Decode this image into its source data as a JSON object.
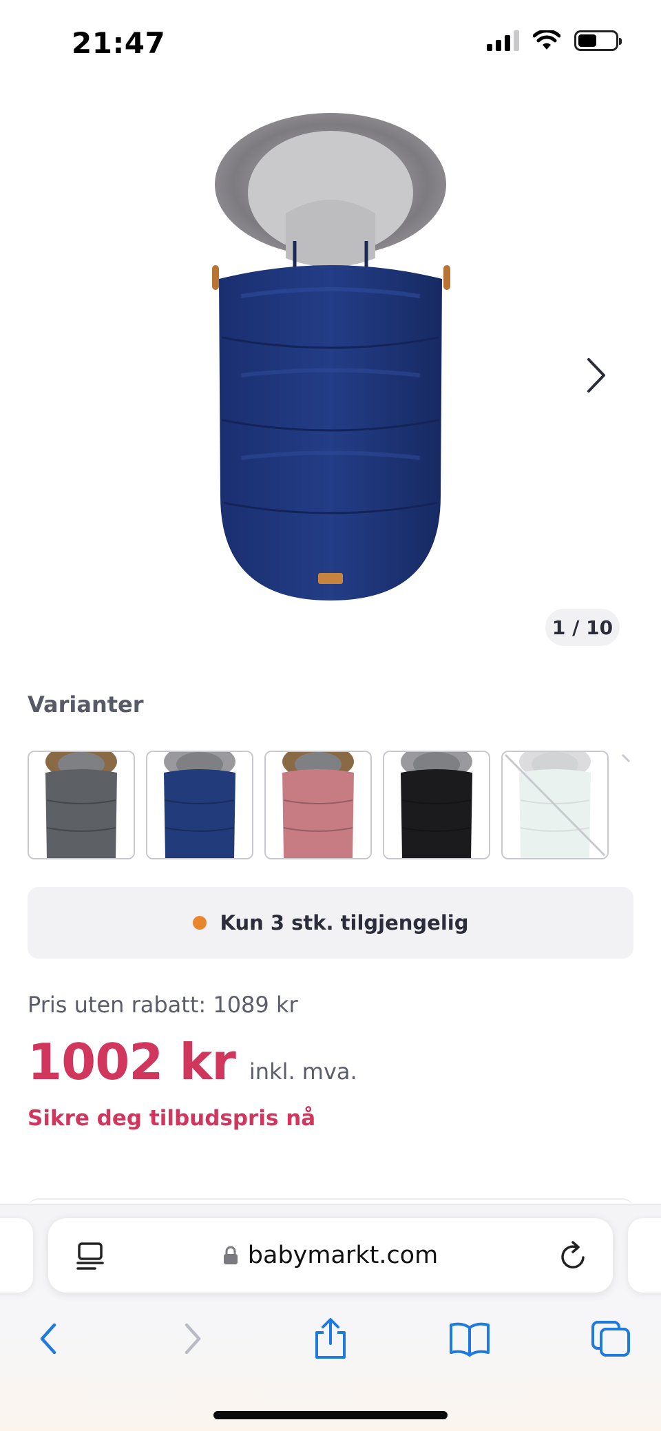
{
  "status_bar": {
    "time": "21:47",
    "icons": [
      "cellular-signal-icon",
      "wifi-icon",
      "battery-icon"
    ]
  },
  "gallery": {
    "counter": "1 / 10",
    "next_icon": "chevron-right-icon"
  },
  "variants": {
    "heading": "Varianter",
    "items": [
      {
        "color": "#5d6064",
        "sold_out": false
      },
      {
        "color": "#223b7a",
        "sold_out": false
      },
      {
        "color": "#c77c84",
        "sold_out": false
      },
      {
        "color": "#1b1b1d",
        "sold_out": false
      },
      {
        "color": "#bfd9d0",
        "sold_out": true
      }
    ]
  },
  "availability": {
    "text": "Kun 3 stk. tilgjengelig",
    "dot_color": "#e8862e"
  },
  "price": {
    "original": "Pris uten rabatt: 1089 kr",
    "current": "1002 kr",
    "vat_note": "inkl. mva.",
    "offer": "Sikre deg tilbudspris nå",
    "accent_color": "#d1365d"
  },
  "browser": {
    "url": "babymarkt.com",
    "toolbar_icons": [
      "back-icon",
      "forward-icon",
      "share-icon",
      "bookmarks-icon",
      "tabs-icon"
    ]
  }
}
